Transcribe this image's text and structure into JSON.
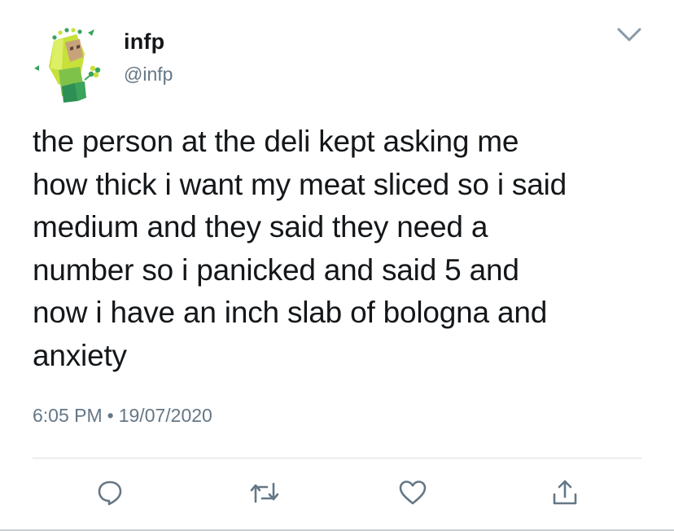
{
  "user": {
    "name": "infp",
    "handle": "@infp",
    "avatar_icon": "infp-character-avatar"
  },
  "tweet": {
    "text": "the person at the deli kept asking me\nhow thick i want my meat sliced so i said\nmedium and they said they need a\nnumber so i panicked and said 5 and\nnow i have an inch slab of bologna and\nanxiety",
    "time": "6:05 PM",
    "separator": "•",
    "date": "19/07/2020"
  },
  "actions": {
    "reply_icon": "reply-icon",
    "retweet_icon": "retweet-icon",
    "like_icon": "heart-icon",
    "share_icon": "share-icon"
  },
  "menu_icon": "chevron-down-icon",
  "colors": {
    "text": "#14171a",
    "secondary": "#657786",
    "avatar_lime": "#c7e03a",
    "avatar_green": "#3aa35c",
    "avatar_skin": "#c8a27a"
  }
}
